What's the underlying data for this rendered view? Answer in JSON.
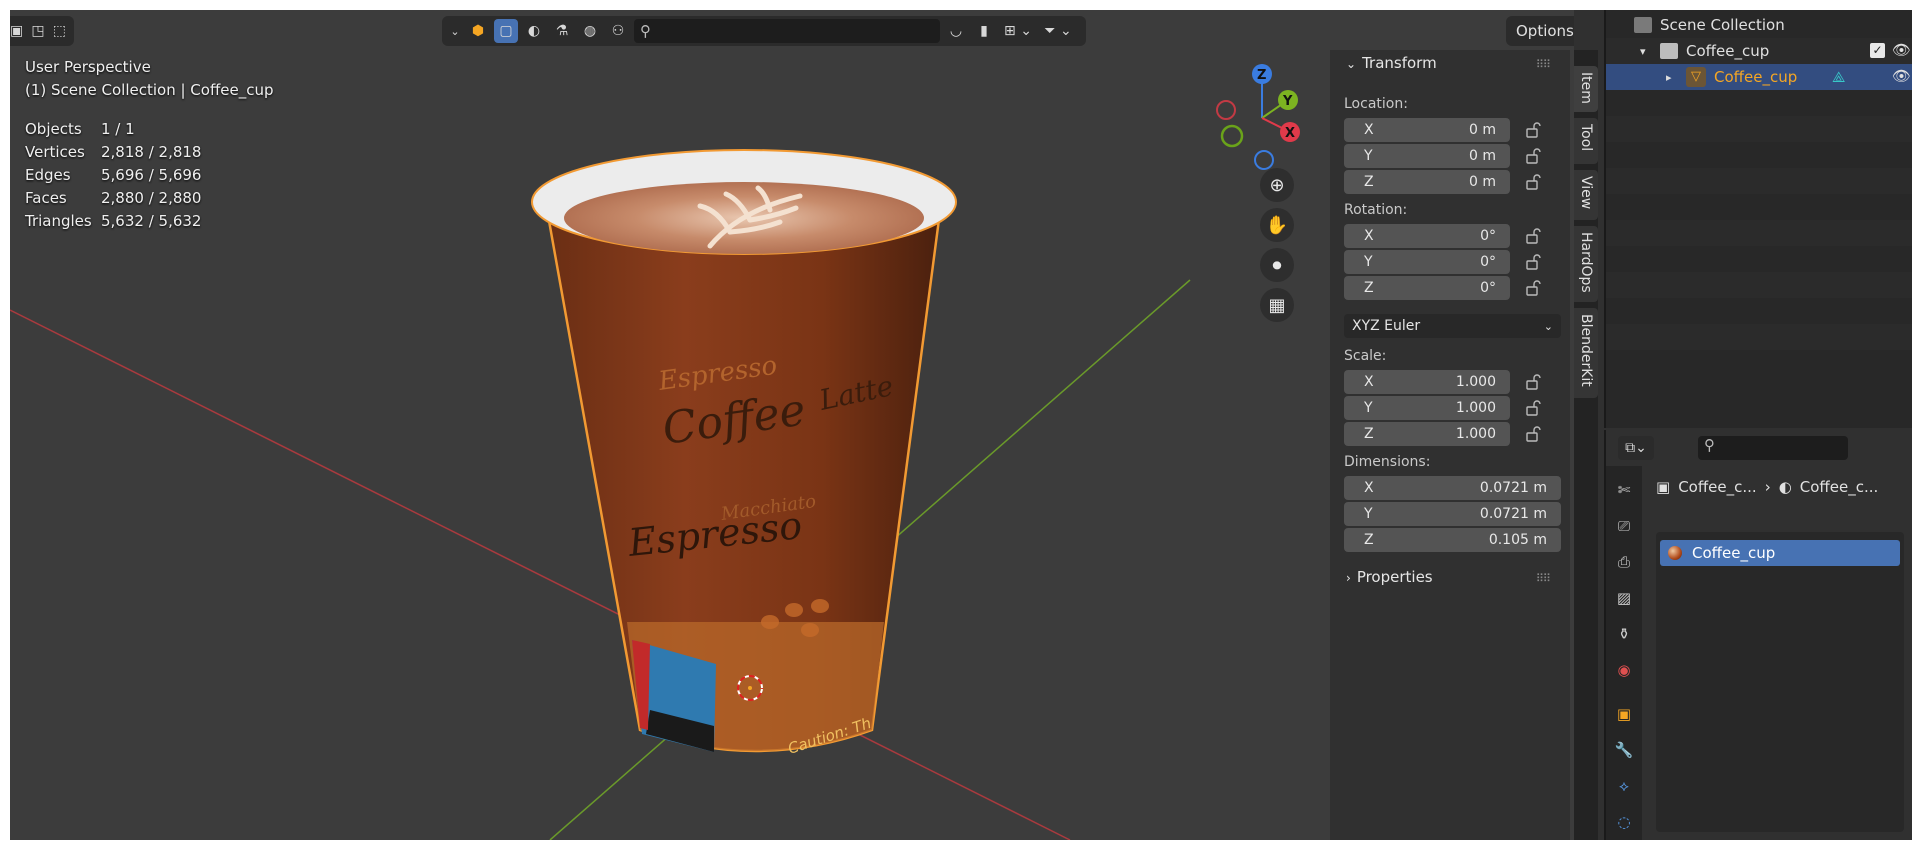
{
  "header": {
    "search_placeholder": "",
    "options_label": "Options"
  },
  "viewport": {
    "view_name": "User Perspective",
    "context": "(1) Scene Collection | Coffee_cup",
    "stats": [
      {
        "label": "Objects",
        "value": "1 / 1"
      },
      {
        "label": "Vertices",
        "value": "2,818 / 2,818"
      },
      {
        "label": "Edges",
        "value": "5,696 / 5,696"
      },
      {
        "label": "Faces",
        "value": "2,880 / 2,880"
      },
      {
        "label": "Triangles",
        "value": "5,632 / 5,632"
      }
    ],
    "cup_text": {
      "espresso_top": "Espresso",
      "coffee": "Coffee",
      "latte": "Latte",
      "macchiato": "Macchiato",
      "espresso": "Espresso",
      "caution": "Caution: Th"
    },
    "gizmo": {
      "x": "X",
      "y": "Y",
      "z": "Z"
    }
  },
  "npanel": {
    "transform_label": "Transform",
    "location_label": "Location:",
    "location": [
      {
        "axis": "X",
        "value": "0 m"
      },
      {
        "axis": "Y",
        "value": "0 m"
      },
      {
        "axis": "Z",
        "value": "0 m"
      }
    ],
    "rotation_label": "Rotation:",
    "rotation": [
      {
        "axis": "X",
        "value": "0°"
      },
      {
        "axis": "Y",
        "value": "0°"
      },
      {
        "axis": "Z",
        "value": "0°"
      }
    ],
    "rotation_mode": "XYZ Euler",
    "scale_label": "Scale:",
    "scale": [
      {
        "axis": "X",
        "value": "1.000"
      },
      {
        "axis": "Y",
        "value": "1.000"
      },
      {
        "axis": "Z",
        "value": "1.000"
      }
    ],
    "dimensions_label": "Dimensions:",
    "dimensions": [
      {
        "axis": "X",
        "value": "0.0721 m"
      },
      {
        "axis": "Y",
        "value": "0.0721 m"
      },
      {
        "axis": "Z",
        "value": "0.105 m"
      }
    ],
    "properties_label": "Properties"
  },
  "tabs": [
    "Item",
    "Tool",
    "View",
    "HardOps",
    "BlenderKit"
  ],
  "outliner": {
    "root": "Scene Collection",
    "collection": "Coffee_cup",
    "object": "Coffee_cup"
  },
  "properties": {
    "breadcrumb_object": "Coffee_c...",
    "breadcrumb_material": "Coffee_c...",
    "material_slot": "Coffee_cup"
  },
  "colors": {
    "selection_orange": "#f5a623",
    "active_blue": "#4772b3",
    "axis_x": "#e03a4a",
    "axis_y": "#7cb321",
    "axis_z": "#3a7ce0"
  }
}
